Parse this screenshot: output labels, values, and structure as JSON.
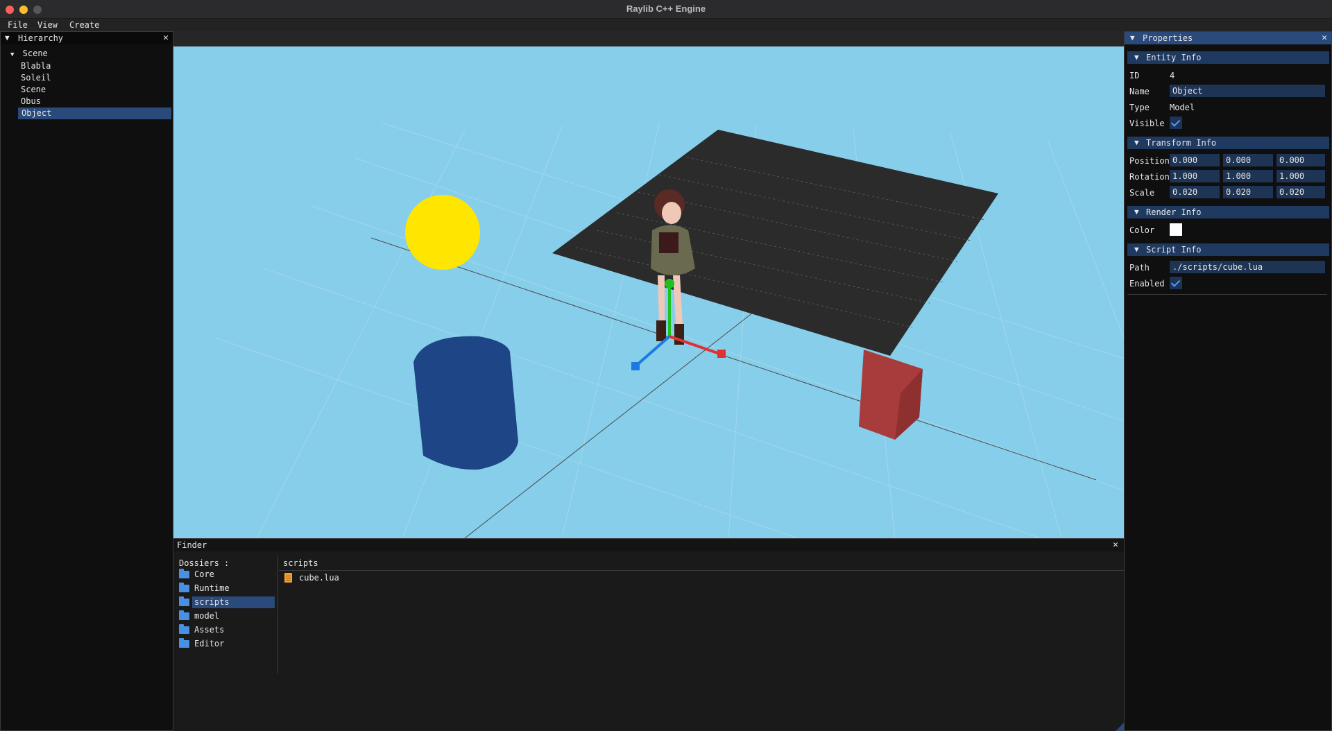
{
  "window": {
    "title": "Raylib C++ Engine"
  },
  "menu": [
    {
      "label": "File"
    },
    {
      "label": "View"
    },
    {
      "label": "Create"
    }
  ],
  "hierarchy": {
    "title": "Hierarchy",
    "root": "Scene",
    "items": [
      {
        "label": "Blabla"
      },
      {
        "label": "Soleil"
      },
      {
        "label": "Scene"
      },
      {
        "label": "Obus"
      },
      {
        "label": "Object",
        "selected": true
      }
    ]
  },
  "properties": {
    "title": "Properties",
    "entity": {
      "header": "Entity Info",
      "id_label": "ID",
      "id_value": "4",
      "name_label": "Name",
      "name_value": "Object",
      "type_label": "Type",
      "type_value": "Model",
      "visible_label": "Visible",
      "visible": true
    },
    "transform": {
      "header": "Transform Info",
      "position_label": "Position",
      "position": [
        "0.000",
        "0.000",
        "0.000"
      ],
      "rotation_label": "Rotation",
      "rotation": [
        "1.000",
        "1.000",
        "1.000"
      ],
      "scale_label": "Scale",
      "scale": [
        "0.020",
        "0.020",
        "0.020"
      ]
    },
    "render": {
      "header": "Render Info",
      "color_label": "Color",
      "color": "#ffffff"
    },
    "script": {
      "header": "Script Info",
      "path_label": "Path",
      "path_value": "./scripts/cube.lua",
      "enabled_label": "Enabled",
      "enabled": true
    }
  },
  "finder": {
    "title": "Finder",
    "folders_label": "Dossiers :",
    "folders": [
      {
        "label": "Core"
      },
      {
        "label": "Runtime"
      },
      {
        "label": "scripts",
        "selected": true
      },
      {
        "label": "model"
      },
      {
        "label": "Assets"
      },
      {
        "label": "Editor"
      }
    ],
    "current_path": "scripts",
    "files": [
      {
        "label": "cube.lua",
        "icon": "lua-file-icon"
      }
    ]
  },
  "colors": {
    "sky": "#87ceeb",
    "selection": "#294a7a",
    "sphere": "#ffe600",
    "cylinder": "#1e4585",
    "cube": "#a83c3c",
    "gizmo_x": "#e03030",
    "gizmo_y": "#20c020",
    "gizmo_z": "#1a7ae0"
  }
}
